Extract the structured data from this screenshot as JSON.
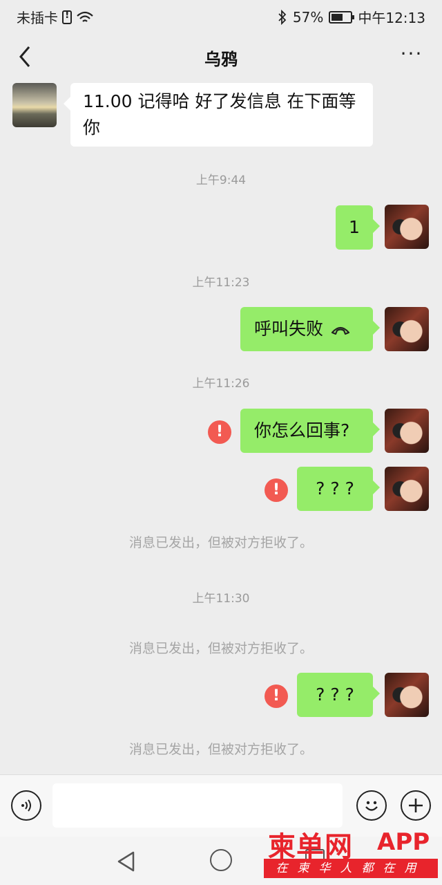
{
  "status_bar": {
    "carrier": "未插卡",
    "battery_percent": "57%",
    "time": "中午12:13"
  },
  "header": {
    "title": "乌鸦"
  },
  "messages": [
    {
      "text": "11.00 记得哈  好了发信息 在下面等你"
    },
    {
      "text": "1"
    },
    {
      "text": "呼叫失败"
    },
    {
      "text": "你怎么回事?"
    },
    {
      "text": "? ? ?"
    },
    {
      "text": "? ? ?"
    }
  ],
  "timestamps": [
    "上午9:44",
    "上午11:23",
    "上午11:26",
    "上午11:30"
  ],
  "system_notes": [
    "消息已发出，但被对方拒收了。",
    "消息已发出，但被对方拒收了。",
    "消息已发出，但被对方拒收了。"
  ],
  "watermark": {
    "logo": "柬单网",
    "suffix": "APP",
    "slogan": "在柬华人都在用"
  },
  "colors": {
    "bubble_out": "#95ec69",
    "bubble_in": "#ffffff",
    "error": "#f25a52",
    "watermark": "#e8242c"
  }
}
